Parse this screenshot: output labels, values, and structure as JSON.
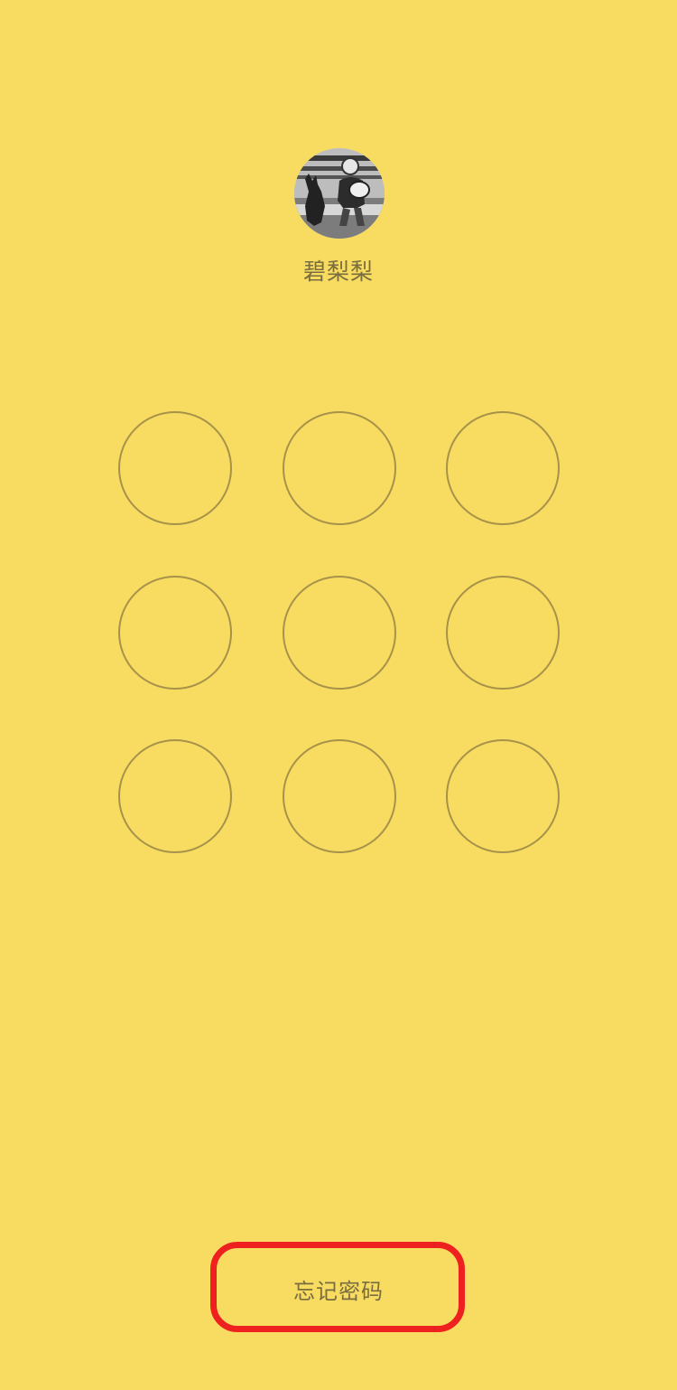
{
  "colors": {
    "background": "#f7dc61",
    "text": "#7a6d3e",
    "node_border": "#a8924a",
    "highlight": "#ee2020"
  },
  "profile": {
    "avatar_icon": "user-photo-avatar",
    "name": "碧梨梨"
  },
  "pattern_lock": {
    "node_count": 9,
    "rows": 3,
    "columns": 3,
    "selected_nodes": []
  },
  "footer": {
    "forgot_password_label": "忘记密码"
  }
}
